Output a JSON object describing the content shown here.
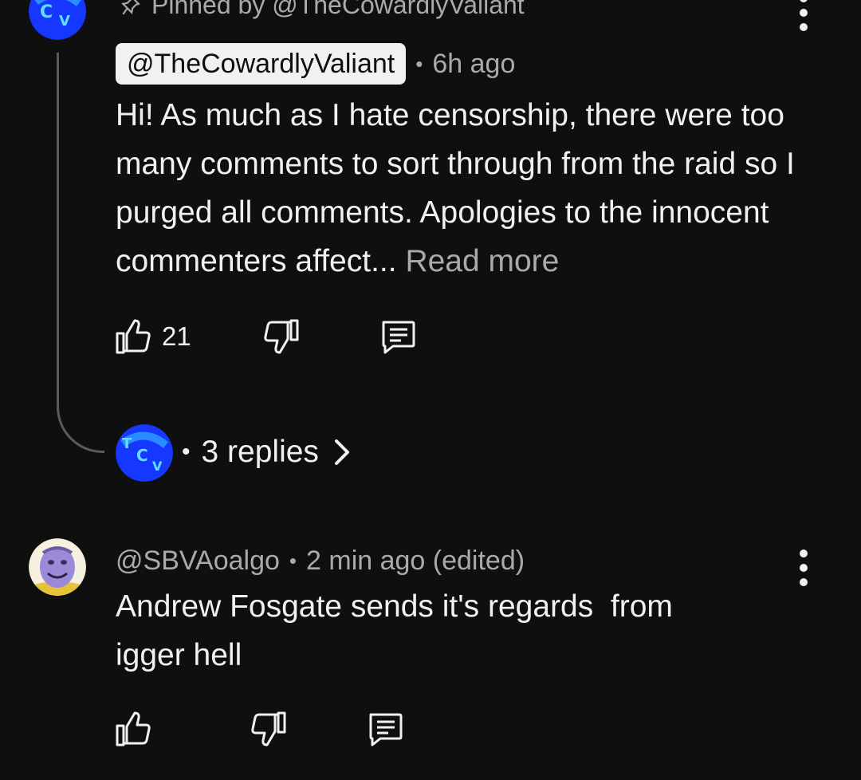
{
  "pinned": {
    "text": "Pinned by @TheCowardlyValiant",
    "icon": "pin-icon"
  },
  "comments": [
    {
      "author": "@TheCowardlyValiant",
      "time": "6h ago",
      "text": "Hi! As much as I hate censorship, there were too many comments to sort through from the raid so I purged all comments. Apologies to the innocent commenters affect...",
      "read_more": "Read more",
      "likes": "21",
      "replies": "3 replies"
    },
    {
      "author": "@SBVAoalgo",
      "time": "2 min ago (edited)",
      "text": "Andrew Fosgate sends it's regards  from\nigger hell",
      "likes": ""
    }
  ],
  "separator": "•",
  "colors": {
    "background": "#0f0f0f",
    "text": "#f1f1f1",
    "muted": "#aaaaaa",
    "avatar_blue": "#1a3cff",
    "avatar_cyan": "#39d2f0"
  }
}
